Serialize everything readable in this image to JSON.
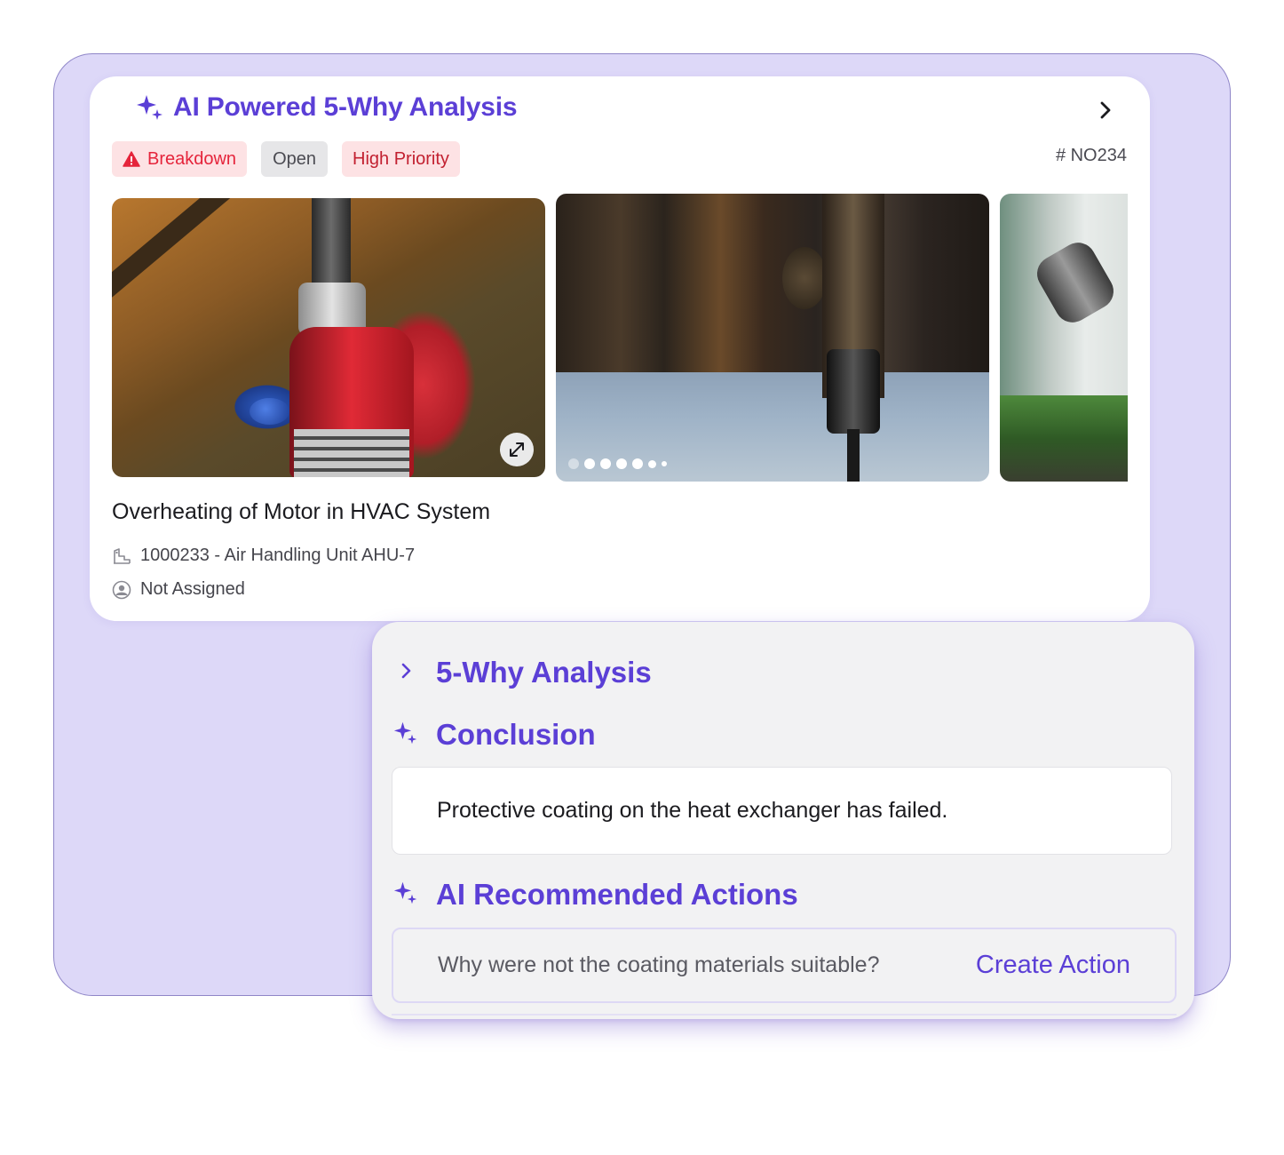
{
  "header": {
    "title": "AI Powered 5-Why Analysis"
  },
  "tags": {
    "breakdown": "Breakdown",
    "status": "Open",
    "priority": "High Priority"
  },
  "ticket": {
    "id": "# NO234"
  },
  "issue": {
    "title": "Overheating of Motor in HVAC System",
    "asset": "1000233 - Air Handling Unit AHU-7",
    "assignee": "Not Assigned"
  },
  "analysis": {
    "why_label": "5-Why Analysis",
    "conclusion_label": "Conclusion",
    "conclusion_text": "Protective coating on the heat exchanger has failed.",
    "actions_label": "AI Recommended Actions",
    "action_question": "Why were not the coating materials suitable?",
    "create_action_label": "Create Action"
  },
  "colors": {
    "accent": "#5b3fd6",
    "backdrop": "#ddd8f8",
    "danger": "#e5243b"
  },
  "icons": {
    "sparkle": "sparkle-icon",
    "chevron": "chevron-right-icon",
    "warning": "warning-icon",
    "expand": "expand-icon",
    "asset": "asset-icon",
    "user": "user-icon"
  }
}
